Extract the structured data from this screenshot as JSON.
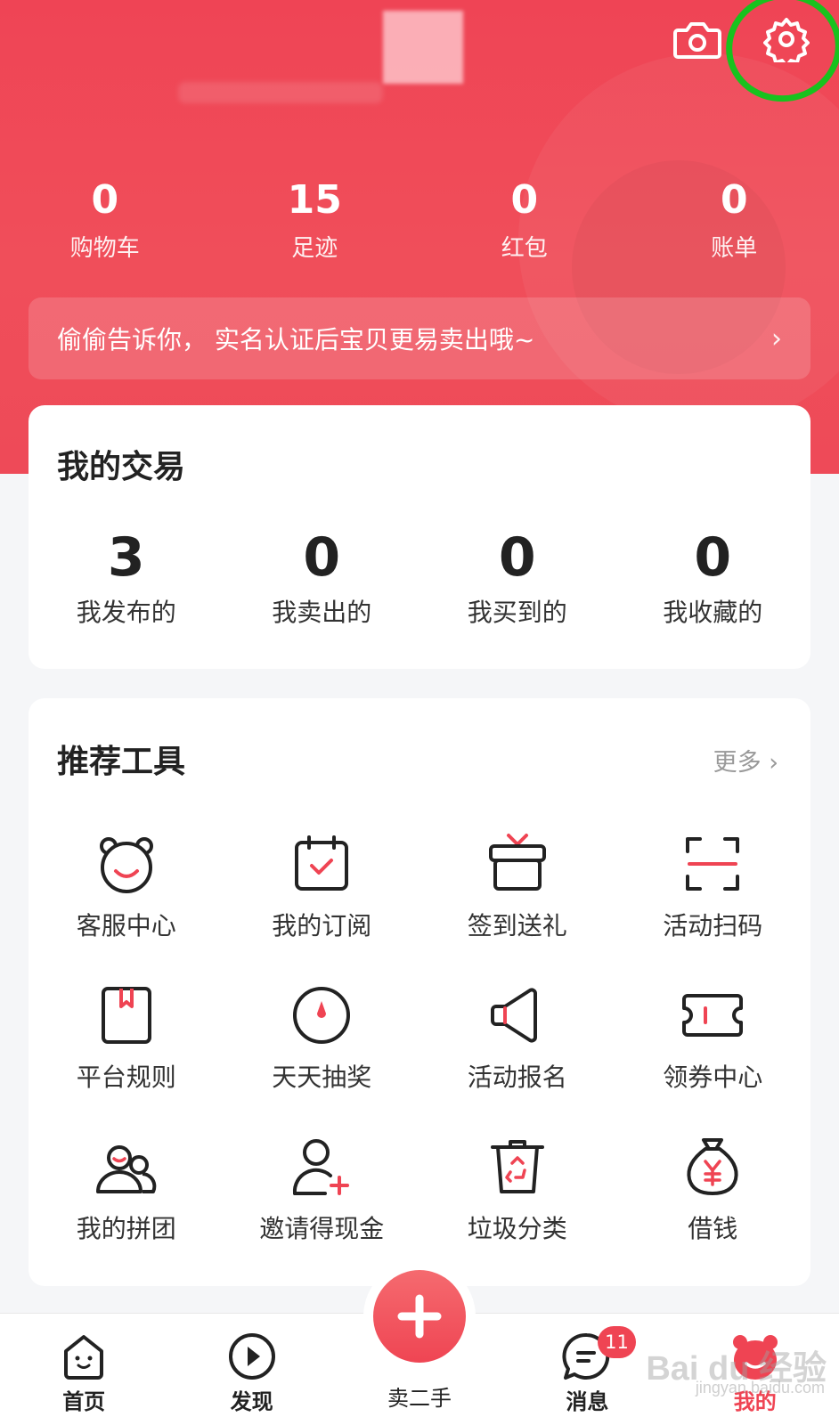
{
  "header": {
    "stats": [
      {
        "value": "0",
        "label": "购物车"
      },
      {
        "value": "15",
        "label": "足迹"
      },
      {
        "value": "0",
        "label": "红包"
      },
      {
        "value": "0",
        "label": "账单"
      }
    ],
    "banner_text": "偷偷告诉你， 实名认证后宝贝更易卖出哦~",
    "banner_chevron": "›"
  },
  "trade": {
    "title": "我的交易",
    "items": [
      {
        "value": "3",
        "label": "我发布的"
      },
      {
        "value": "0",
        "label": "我卖出的"
      },
      {
        "value": "0",
        "label": "我买到的"
      },
      {
        "value": "0",
        "label": "我收藏的"
      }
    ]
  },
  "tools": {
    "title": "推荐工具",
    "more": "更多 ›",
    "items": [
      {
        "label": "客服中心",
        "icon": "bear-face-icon"
      },
      {
        "label": "我的订阅",
        "icon": "calendar-check-icon"
      },
      {
        "label": "签到送礼",
        "icon": "gift-box-icon"
      },
      {
        "label": "活动扫码",
        "icon": "scan-icon"
      },
      {
        "label": "平台规则",
        "icon": "rule-book-icon"
      },
      {
        "label": "天天抽奖",
        "icon": "lottery-dial-icon"
      },
      {
        "label": "活动报名",
        "icon": "megaphone-icon"
      },
      {
        "label": "领券中心",
        "icon": "coupon-icon"
      },
      {
        "label": "我的拼团",
        "icon": "group-users-icon"
      },
      {
        "label": "邀请得现金",
        "icon": "add-user-icon"
      },
      {
        "label": "垃圾分类",
        "icon": "recycle-bin-icon"
      },
      {
        "label": "借钱",
        "icon": "money-bag-icon"
      }
    ]
  },
  "tabbar": {
    "tabs": [
      {
        "label": "首页",
        "icon": "home-face-icon"
      },
      {
        "label": "发现",
        "icon": "play-circle-icon"
      },
      {
        "label": "卖二手",
        "icon": "plus-icon"
      },
      {
        "label": "消息",
        "icon": "message-icon",
        "badge": "11"
      },
      {
        "label": "我的",
        "icon": "bear-profile-icon"
      }
    ]
  },
  "watermark": {
    "main": "Bai du 经验",
    "sub": "jingyan.baidu.com"
  },
  "colors": {
    "accent": "#ef4453",
    "highlight_circle": "#18c21e"
  }
}
